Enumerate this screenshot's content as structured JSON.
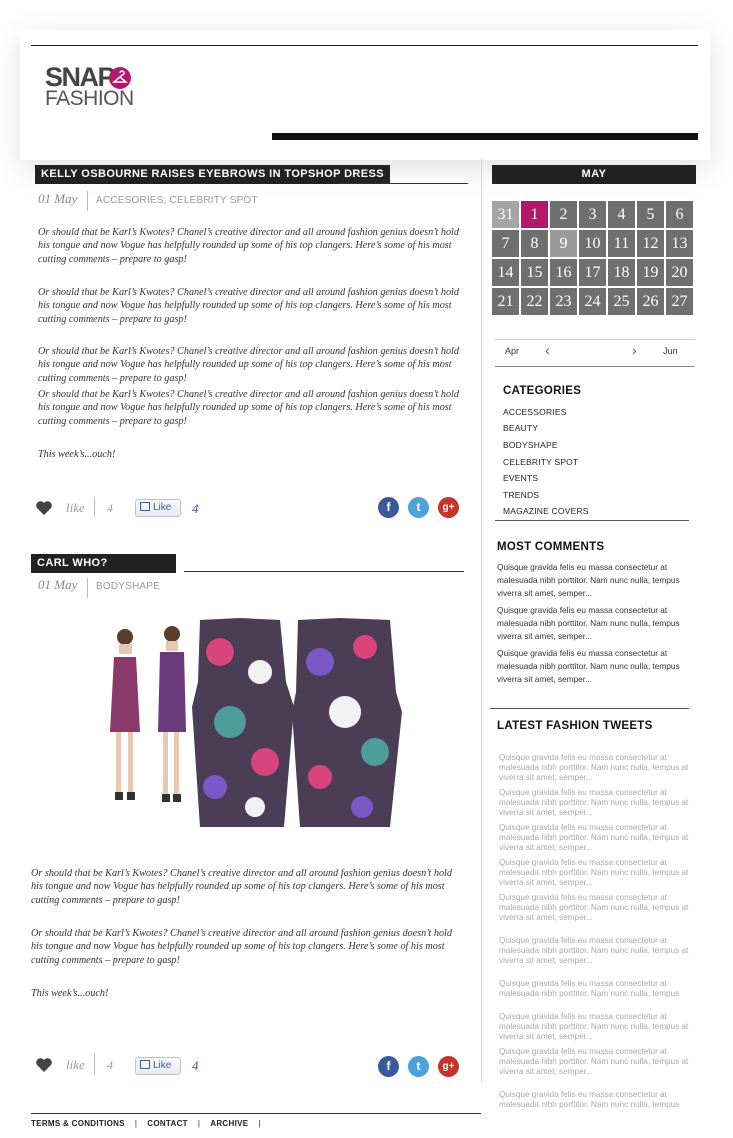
{
  "brand": {
    "line1": "SNAP",
    "line2": "FASHION",
    "accent": "#b5186b"
  },
  "posts": [
    {
      "title": "KELLY OSBOURNE RAISES EYEBROWS IN TOPSHOP DRESS",
      "date": "01 May",
      "categories": "ACCESORIES, CELEBRITY SPOT",
      "paragraphs": [
        "Or should that be Karl’s Kwotes? Chanel’s creative director and all around fashion genius doesn’t hold his tongue and now Vogue has helpfully rounded up some of his top clangers. Here’s some of his most cutting comments – prepare to gasp!",
        "Or should that be Karl’s Kwotes? Chanel’s creative director and all around fashion genius doesn’t hold his tongue and now Vogue has helpfully rounded up some of his top clangers. Here’s some of his most cutting comments – prepare to gasp!",
        "Or should that be Karl’s Kwotes? Chanel’s creative director and all around fashion genius doesn’t hold his tongue and now Vogue has helpfully rounded up some of his top clangers. Here’s some of his most cutting comments – prepare to gasp!",
        "Or should that be Karl’s Kwotes? Chanel’s creative director and all around fashion genius doesn’t hold his tongue and now Vogue has helpfully rounded up some of his top clangers. Here’s some of his most cutting comments – prepare to gasp!",
        "This week’s...ouch!"
      ],
      "like_label": "like",
      "like_count": "4",
      "fb_like_label": "Like",
      "fb_count": "4"
    },
    {
      "title": "CARL WHO?",
      "date": "01 May",
      "categories": "BODYSHAPE",
      "paragraphs": [
        "Or should that be Karl’s Kwotes? Chanel’s creative director and all around fashion genius doesn’t hold his tongue and now Vogue has helpfully rounded up some of his top clangers. Here’s some of his most cutting comments – prepare to gasp!",
        "Or should that be Karl’s Kwotes? Chanel’s creative director and all around fashion genius doesn’t hold his tongue and now Vogue has helpfully rounded up some of his top clangers. Here’s some of his most cutting comments – prepare to gasp!",
        "This week’s...ouch!"
      ],
      "like_label": "like",
      "like_count": "4",
      "fb_like_label": "Like",
      "fb_count": "4"
    }
  ],
  "social": {
    "facebook": "f",
    "twitter": "t",
    "google": "g+"
  },
  "calendar": {
    "month": "MAY",
    "days": [
      "31",
      "1",
      "2",
      "3",
      "4",
      "5",
      "6",
      "7",
      "8",
      "9",
      "10",
      "11",
      "12",
      "13",
      "14",
      "15",
      "16",
      "17",
      "18",
      "19",
      "20",
      "21",
      "22",
      "23",
      "24",
      "25",
      "26",
      "27"
    ],
    "selected": "1",
    "prev": "Apr",
    "next": "Jun"
  },
  "categories": {
    "title": "CATEGORIES",
    "items": [
      "ACCESSORIES",
      "BEAUTY",
      "BODYSHAPE",
      "CELEBRITY SPOT",
      "EVENTS",
      "TRENDS",
      "MAGAZINE COVERS"
    ]
  },
  "most_comments": {
    "title": "MOST COMMENTS",
    "items": [
      "Quisque gravida felis eu massa consectetur at malesuada nibh porttitor. Nam nunc nulla, tempus viverra sit amet, semper...",
      "Quisque gravida felis eu massa consectetur at malesuada nibh porttitor. Nam nunc nulla, tempus viverra sit amet, semper...",
      "Quisque gravida felis eu massa consectetur at malesuada nibh porttitor. Nam nunc nulla, tempus viverra sit amet, semper..."
    ]
  },
  "tweets": {
    "title": "LATEST FASHION TWEETS",
    "items": [
      "Quisque gravida felis eu massa consectetur at malesuada nibh porttitor. Nam nunc nulla, tempus at viverra sit amet, semper...",
      "Quisque gravida felis eu massa consectetur at malesuada nibh porttitor. Nam nunc nulla, tempus at viverra sit amet, semper...",
      "Quisque gravida felis eu massa consectetur at malesuada nibh porttitor. Nam nunc nulla, tempus at viverra sit amet, semper...",
      "Quisque gravida felis eu massa consectetur at malesuada nibh porttitor. Nam nunc nulla, tempus at viverra sit amet, semper...",
      "Quisque gravida felis eu massa consectetur at malesuada nibh porttitor. Nam nunc nulla, tempus at viverra sit amet, semper...",
      "Quisque gravida felis eu massa consectetur at malesuada nibh porttitor. Nam nunc nulla, tempus at viverra sit amet, semper...",
      "Quisque gravida felis eu massa consectetur at malesuada nibh porttitor. Nam nunc nulla, tempus",
      "Quisque gravida felis eu massa consectetur at malesuada nibh porttitor. Nam nunc nulla, tempus at viverra sit amet, semper...",
      "Quisque gravida felis eu massa consectetur at malesuada nibh porttitor. Nam nunc nulla, tempus at viverra sit amet, semper...",
      "Quisque gravida felis eu massa consectetur at malesuada nibh porttitor. Nam nunc nulla, tempus"
    ]
  },
  "footer": {
    "links": [
      "TERMS & CONDITIONS",
      "CONTACT",
      "ARCHIVE"
    ]
  }
}
